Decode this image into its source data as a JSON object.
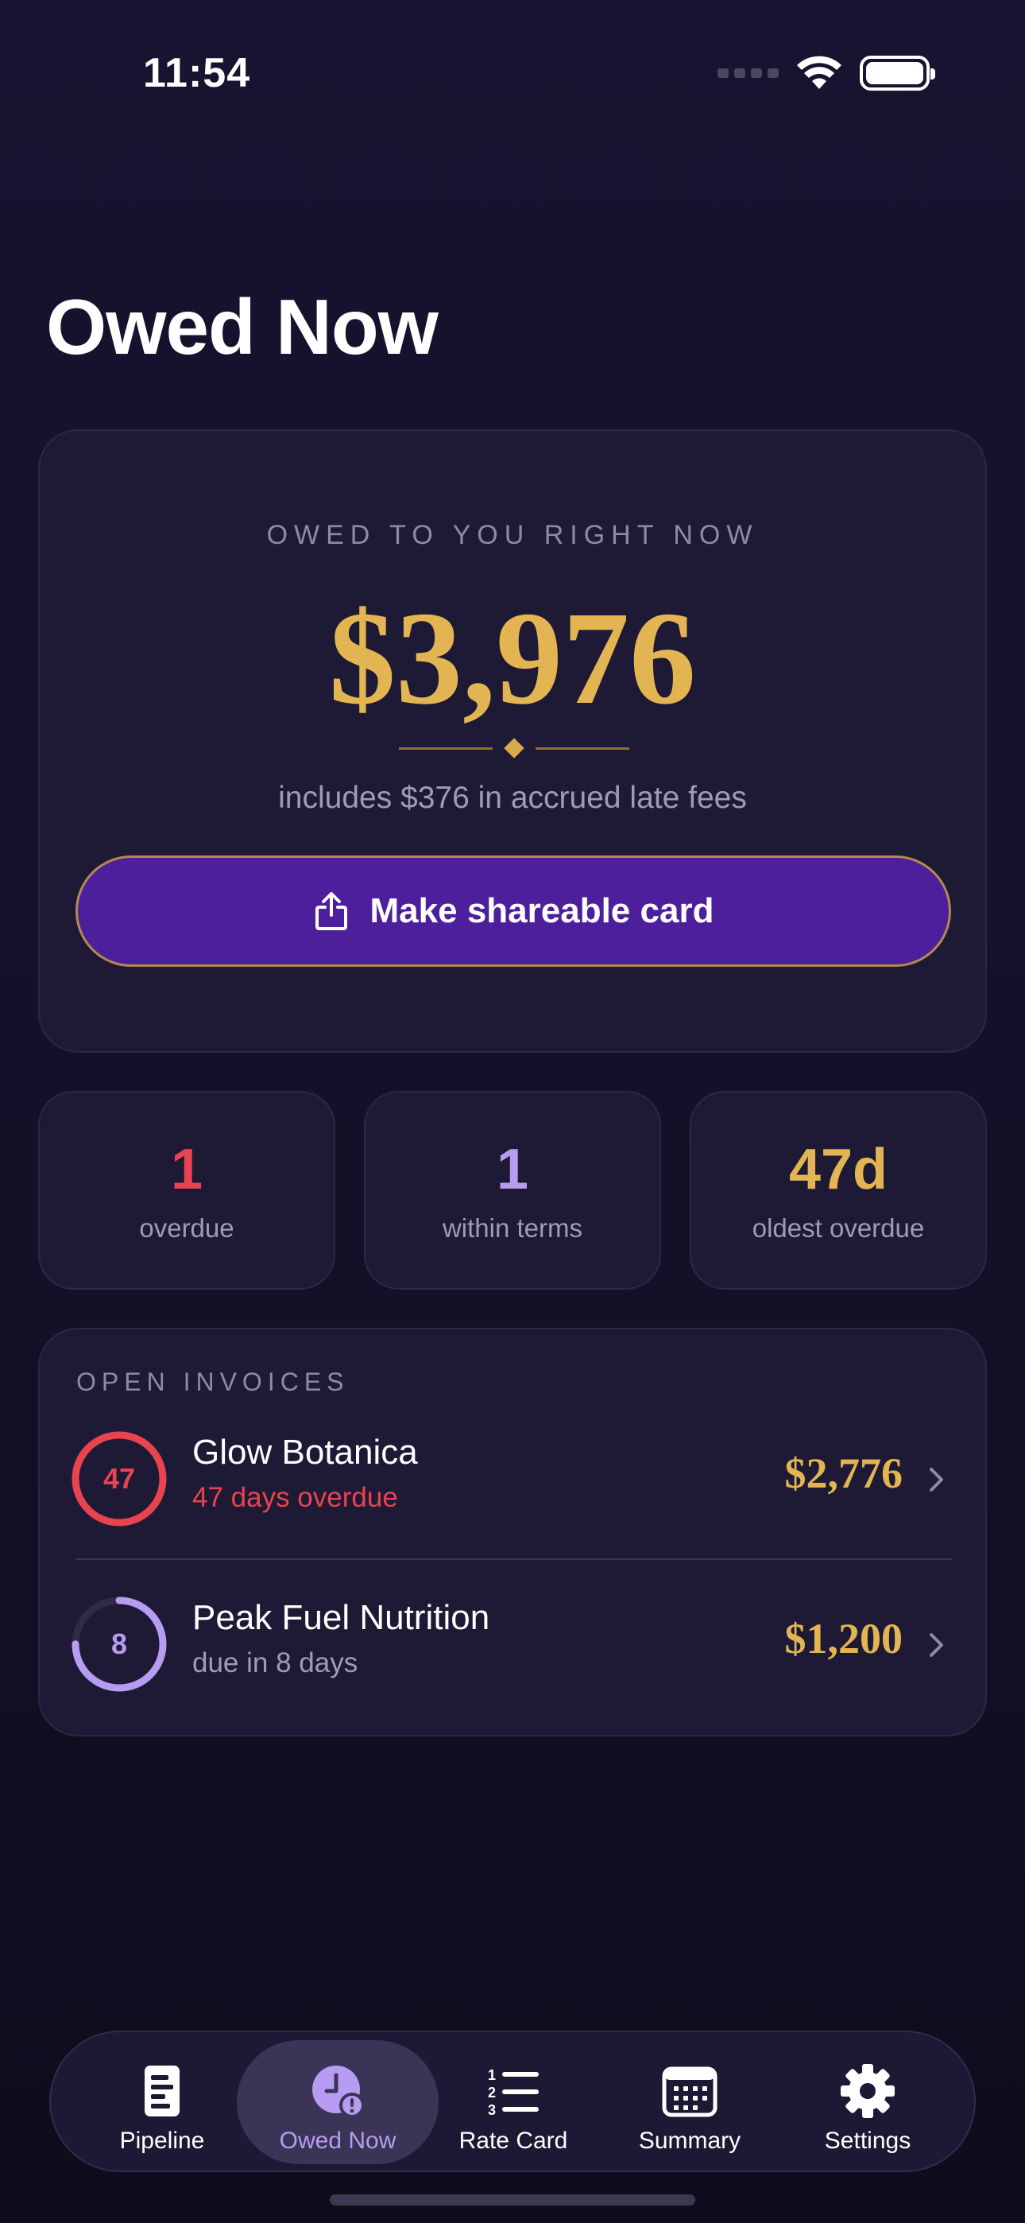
{
  "status_bar": {
    "time": "11:54"
  },
  "page": {
    "title": "Owed Now"
  },
  "hero": {
    "label": "OWED TO YOU RIGHT NOW",
    "amount": "$3,976",
    "subtitle": "includes $376 in accrued late fees",
    "share_button_label": "Make shareable card"
  },
  "stats": [
    {
      "value": "1",
      "label": "overdue",
      "color": "#e8434f"
    },
    {
      "value": "1",
      "label": "within terms",
      "color": "#b79cf2"
    },
    {
      "value": "47d",
      "label": "oldest overdue",
      "color": "#e3b552"
    }
  ],
  "invoices": {
    "section_label": "OPEN INVOICES",
    "items": [
      {
        "ring_value": "47",
        "ring_progress": 1.0,
        "ring_color": "#e8434f",
        "name": "Glow Botanica",
        "status": "47 days overdue",
        "status_color": "#e8434f",
        "amount": "$2,776"
      },
      {
        "ring_value": "8",
        "ring_progress": 0.75,
        "ring_color": "#b79cf2",
        "name": "Peak Fuel Nutrition",
        "status": "due in 8 days",
        "status_color": "#a09bb4",
        "amount": "$1,200"
      }
    ]
  },
  "tabbar": {
    "active": "Owed Now",
    "tabs": [
      {
        "label": "Pipeline",
        "icon": "document-icon"
      },
      {
        "label": "Owed Now",
        "icon": "clock-alert-icon"
      },
      {
        "label": "Rate Card",
        "icon": "numbered-list-icon"
      },
      {
        "label": "Summary",
        "icon": "calendar-icon"
      },
      {
        "label": "Settings",
        "icon": "gear-icon"
      }
    ]
  },
  "colors": {
    "accent_gold": "#e3b552",
    "accent_purple": "#4e1f9c",
    "overdue_red": "#e8434f",
    "lavender": "#b79cf2"
  }
}
